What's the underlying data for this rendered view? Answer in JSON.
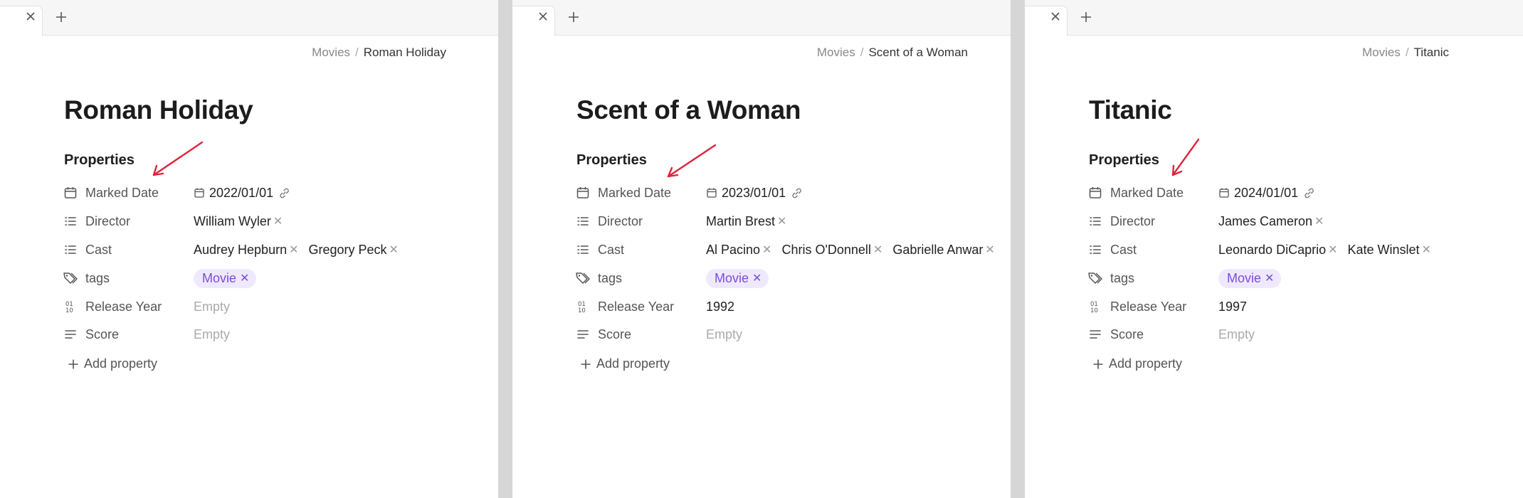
{
  "panels": [
    {
      "breadcrumb": {
        "parent": "Movies",
        "separator": "/",
        "current": "Roman Holiday"
      },
      "title": "Roman Holiday",
      "properties_heading": "Properties",
      "properties": {
        "marked_date": {
          "label": "Marked Date",
          "value": "2022/01/01"
        },
        "director": {
          "label": "Director",
          "values": [
            "William Wyler"
          ]
        },
        "cast": {
          "label": "Cast",
          "values": [
            "Audrey Hepburn",
            "Gregory Peck"
          ]
        },
        "tags": {
          "label": "tags",
          "values": [
            "Movie"
          ]
        },
        "release_year": {
          "label": "Release Year",
          "value": "Empty",
          "is_empty": true
        },
        "score": {
          "label": "Score",
          "value": "Empty",
          "is_empty": true
        }
      },
      "add_property_label": "Add property"
    },
    {
      "breadcrumb": {
        "parent": "Movies",
        "separator": "/",
        "current": "Scent of a Woman"
      },
      "title": "Scent of a Woman",
      "properties_heading": "Properties",
      "properties": {
        "marked_date": {
          "label": "Marked Date",
          "value": "2023/01/01"
        },
        "director": {
          "label": "Director",
          "values": [
            "Martin Brest"
          ]
        },
        "cast": {
          "label": "Cast",
          "values": [
            "Al Pacino",
            "Chris O'Donnell",
            "Gabrielle Anwar"
          ]
        },
        "tags": {
          "label": "tags",
          "values": [
            "Movie"
          ]
        },
        "release_year": {
          "label": "Release Year",
          "value": "1992",
          "is_empty": false
        },
        "score": {
          "label": "Score",
          "value": "Empty",
          "is_empty": true
        }
      },
      "add_property_label": "Add property"
    },
    {
      "breadcrumb": {
        "parent": "Movies",
        "separator": "/",
        "current": "Titanic"
      },
      "title": "Titanic",
      "properties_heading": "Properties",
      "properties": {
        "marked_date": {
          "label": "Marked Date",
          "value": "2024/01/01"
        },
        "director": {
          "label": "Director",
          "values": [
            "James Cameron"
          ]
        },
        "cast": {
          "label": "Cast",
          "values": [
            "Leonardo DiCaprio",
            "Kate Winslet"
          ]
        },
        "tags": {
          "label": "tags",
          "values": [
            "Movie"
          ]
        },
        "release_year": {
          "label": "Release Year",
          "value": "1997",
          "is_empty": false
        },
        "score": {
          "label": "Score",
          "value": "Empty",
          "is_empty": true
        }
      },
      "add_property_label": "Add property"
    }
  ],
  "icons": {
    "tab_close": "close-icon",
    "tab_new": "plus-icon",
    "marked_date": "calendar-icon",
    "director": "list-icon",
    "cast": "list-icon",
    "tags": "tags-icon",
    "release_year": "number-icon",
    "score": "text-lines-icon",
    "add_property": "plus-icon",
    "remove_chip": "close-icon",
    "date_value": "calendar-icon",
    "date_link": "link-icon",
    "annotation": "red-arrow-icon"
  },
  "colors": {
    "tag_bg": "#efe9ff",
    "tag_text": "#7c4dd8",
    "annotation_arrow": "#e0223a",
    "divider": "#d6d6d6"
  }
}
